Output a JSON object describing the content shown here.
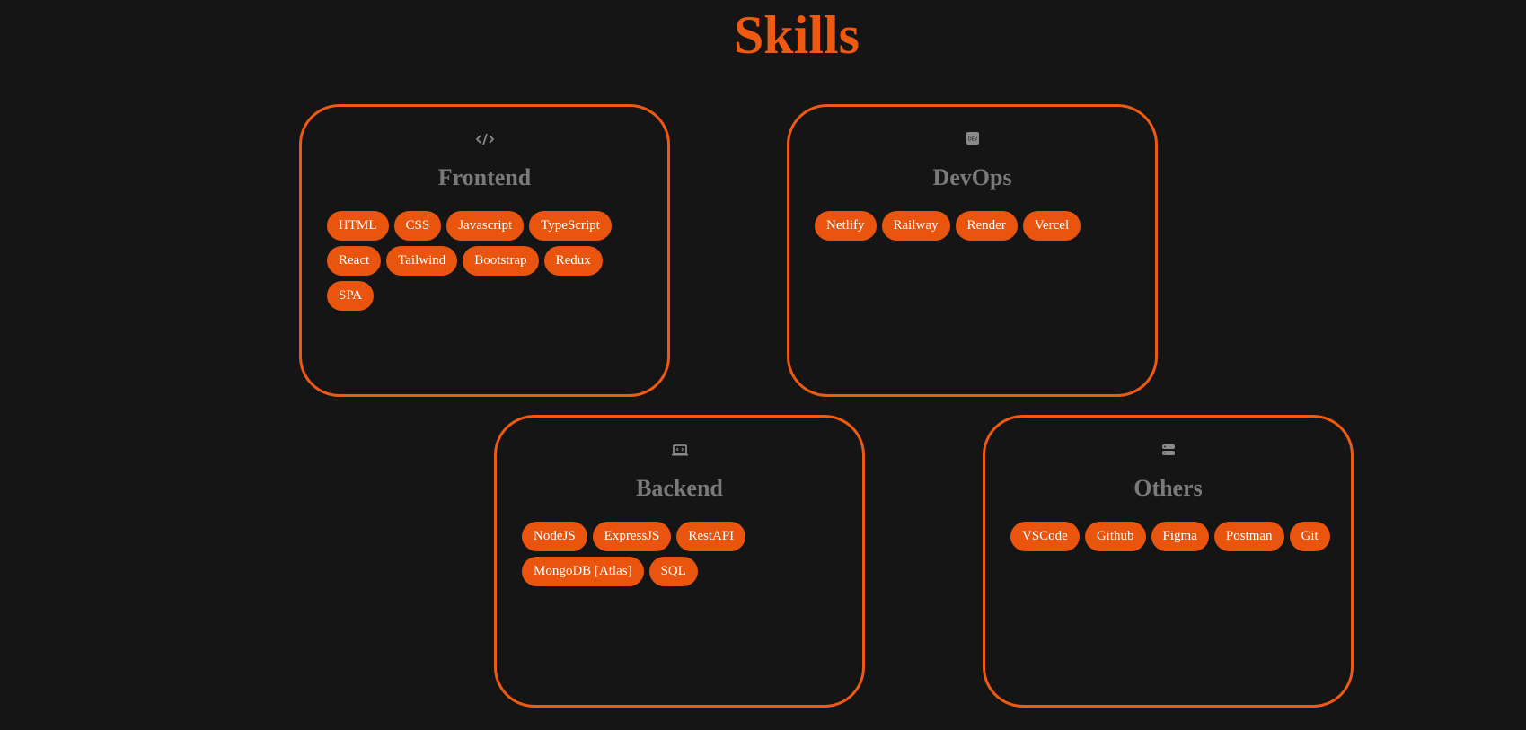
{
  "title": "Skills",
  "colors": {
    "background": "#151515",
    "accent": "#ee5a12",
    "tag_bg": "#e9540f",
    "card_title": "#7a7a7a",
    "icon": "#8a8a8a"
  },
  "cards": [
    {
      "icon": "code-icon",
      "title": "Frontend",
      "tags": [
        "HTML",
        "CSS",
        "Javascript",
        "TypeScript",
        "React",
        "Tailwind",
        "Bootstrap",
        "Redux",
        "SPA"
      ]
    },
    {
      "icon": "dev-badge-icon",
      "icon_text": "DEV",
      "title": "DevOps",
      "tags": [
        "Netlify",
        "Railway",
        "Render",
        "Vercel"
      ]
    },
    {
      "icon": "laptop-code-icon",
      "title": "Backend",
      "tags": [
        "NodeJS",
        "ExpressJS",
        "RestAPI",
        "MongoDB [Atlas]",
        "SQL"
      ]
    },
    {
      "icon": "server-icon",
      "title": "Others",
      "tags": [
        "VSCode",
        "Github",
        "Figma",
        "Postman",
        "Git"
      ]
    }
  ]
}
